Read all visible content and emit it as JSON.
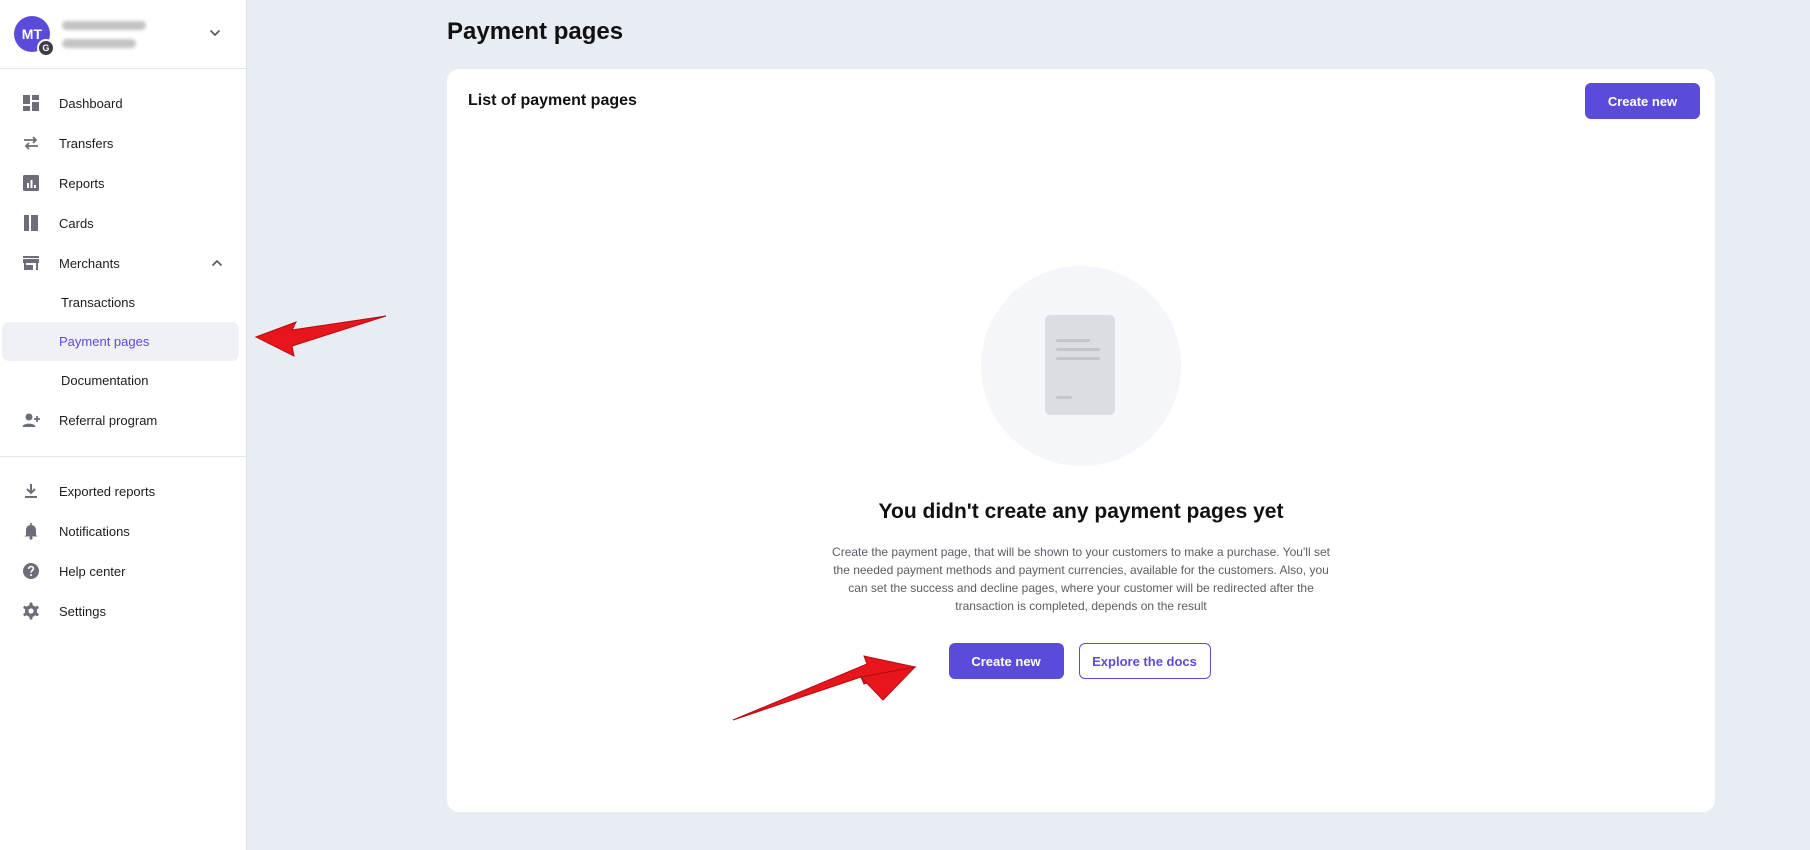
{
  "account": {
    "initials": "MT",
    "badge": "G"
  },
  "sidebar": {
    "items": [
      {
        "label": "Dashboard",
        "icon": "dashboard-icon"
      },
      {
        "label": "Transfers",
        "icon": "transfers-icon"
      },
      {
        "label": "Reports",
        "icon": "reports-icon"
      },
      {
        "label": "Cards",
        "icon": "cards-icon"
      },
      {
        "label": "Merchants",
        "icon": "store-icon"
      }
    ],
    "merchant_subitems": [
      {
        "label": "Transactions"
      },
      {
        "label": "Payment pages",
        "active": true
      },
      {
        "label": "Documentation"
      }
    ],
    "referral": {
      "label": "Referral program",
      "icon": "add-person-icon"
    },
    "bottom_items": [
      {
        "label": "Exported reports",
        "icon": "download-icon"
      },
      {
        "label": "Notifications",
        "icon": "bell-icon"
      },
      {
        "label": "Help center",
        "icon": "help-icon"
      },
      {
        "label": "Settings",
        "icon": "gear-icon"
      }
    ]
  },
  "page": {
    "title": "Payment pages"
  },
  "card": {
    "title": "List of payment pages",
    "create_label": "Create new"
  },
  "empty_state": {
    "title": "You didn't create any payment pages yet",
    "description": "Create the payment page, that will be shown to your customers to make a purchase. You'll set the needed payment methods and payment currencies, available for the customers. Also, you can set the success and decline pages, where your customer will be redirected after the transaction is completed, depends on the result",
    "create_label": "Create new",
    "docs_label": "Explore the docs"
  },
  "colors": {
    "accent": "#5b4bdb",
    "page_background": "#e8ecf3",
    "annotation_arrow": "#e8161c"
  }
}
